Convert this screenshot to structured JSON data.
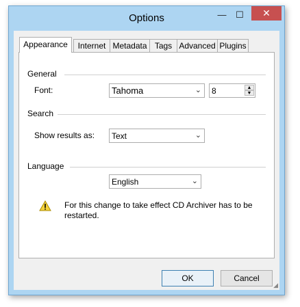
{
  "window": {
    "title": "Options",
    "minimize_glyph": "—",
    "maximize_glyph": "☐",
    "close_glyph": "✕"
  },
  "tabs": [
    {
      "label": "Appearance",
      "active": true
    },
    {
      "label": "Internet",
      "active": false
    },
    {
      "label": "Metadata",
      "active": false
    },
    {
      "label": "Tags",
      "active": false
    },
    {
      "label": "Advanced",
      "active": false
    },
    {
      "label": "Plugins",
      "active": false
    }
  ],
  "general": {
    "heading": "General",
    "font_label": "Font:",
    "font_value": "Tahoma",
    "size_value": "8"
  },
  "search": {
    "heading": "Search",
    "show_label": "Show results as:",
    "show_value": "Text"
  },
  "language": {
    "heading": "Language",
    "value": "English",
    "note": "For this change to take effect CD Archiver has to be restarted."
  },
  "buttons": {
    "ok": "OK",
    "cancel": "Cancel"
  },
  "icons": {
    "warning": "warning-icon",
    "dropdown": "chevron-down-icon"
  },
  "colors": {
    "frame": "#add5f2",
    "close": "#c75050",
    "accent": "#3c7fb1"
  }
}
